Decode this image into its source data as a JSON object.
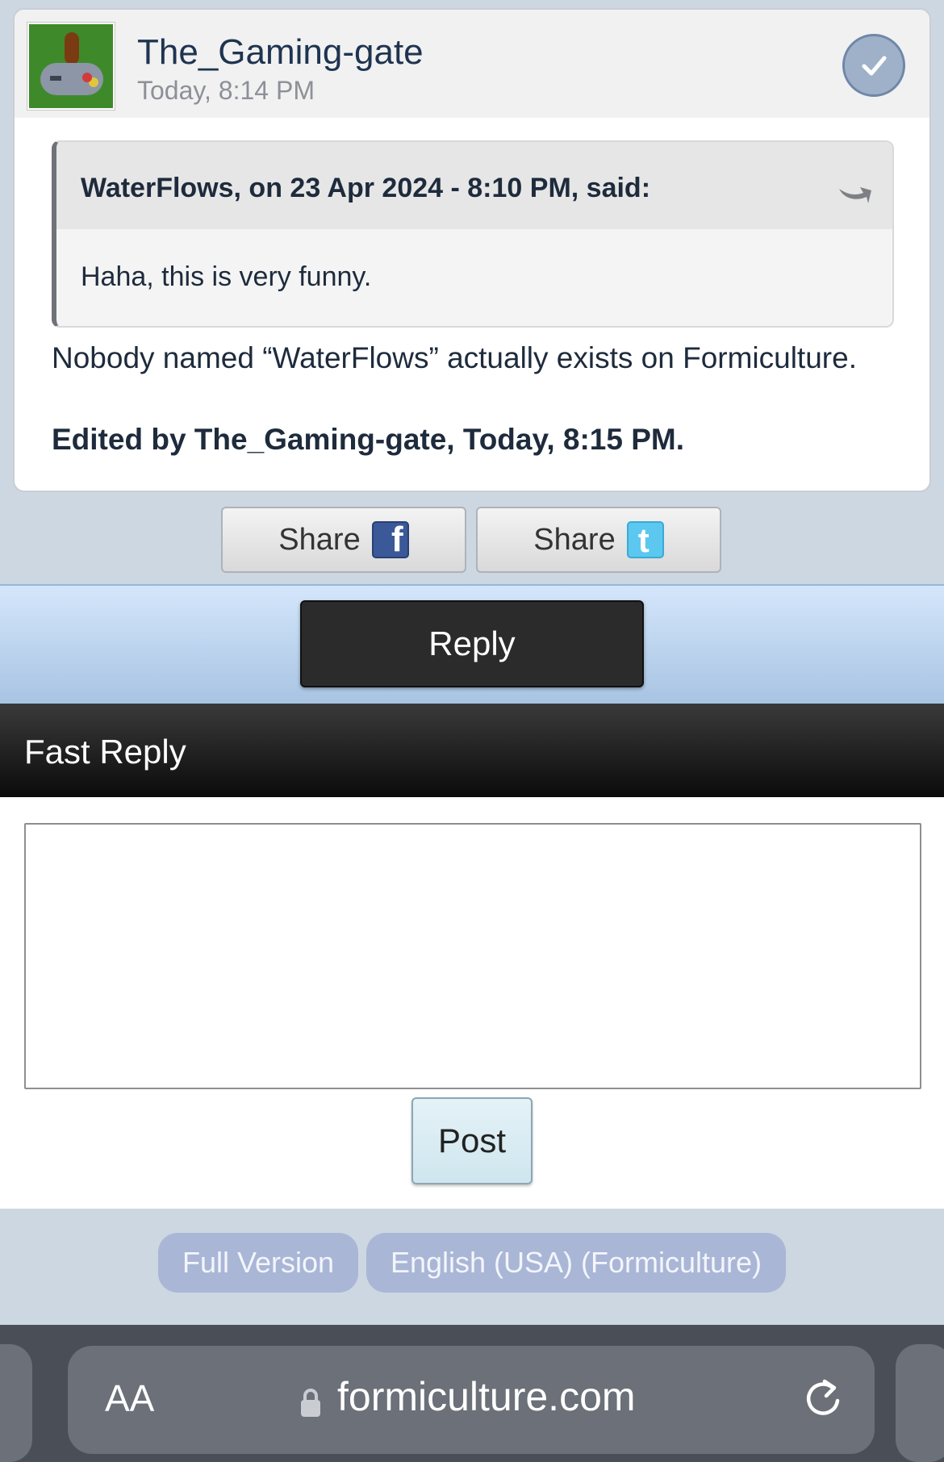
{
  "post": {
    "author": "The_Gaming-gate",
    "time": "Today, 8:14 PM",
    "quote": {
      "citation": "WaterFlows, on 23 Apr 2024 - 8:10 PM, said:",
      "body": "Haha, this is very funny."
    },
    "text": "Nobody named “WaterFlows” actually exists on Formiculture.",
    "edited": "Edited by The_Gaming-gate, Today, 8:15 PM."
  },
  "share": {
    "facebook_label": "Share",
    "twitter_label": "Share"
  },
  "reply_button": "Reply",
  "fast_reply": {
    "title": "Fast Reply",
    "textarea_value": "",
    "post_button": "Post"
  },
  "footer": {
    "full_version": "Full Version",
    "language": "English (USA) (Formiculture)"
  },
  "browser": {
    "text_size_label": "AA",
    "url": "formiculture.com"
  },
  "icons": {
    "avatar": "gamepad-ant-avatar",
    "badge": "checkmark-icon",
    "quote": "quote-arrow-icon",
    "facebook": "facebook-icon",
    "twitter": "twitter-icon",
    "lock": "lock-icon",
    "reload": "reload-icon"
  },
  "colors": {
    "page_bg": "#cdd7e2",
    "reply_button_bg": "#2b2b2b",
    "fast_reply_bar": "#0b0b0b",
    "pill_bg": "#a9b6d6",
    "browser_bar": "#4a4f57"
  }
}
